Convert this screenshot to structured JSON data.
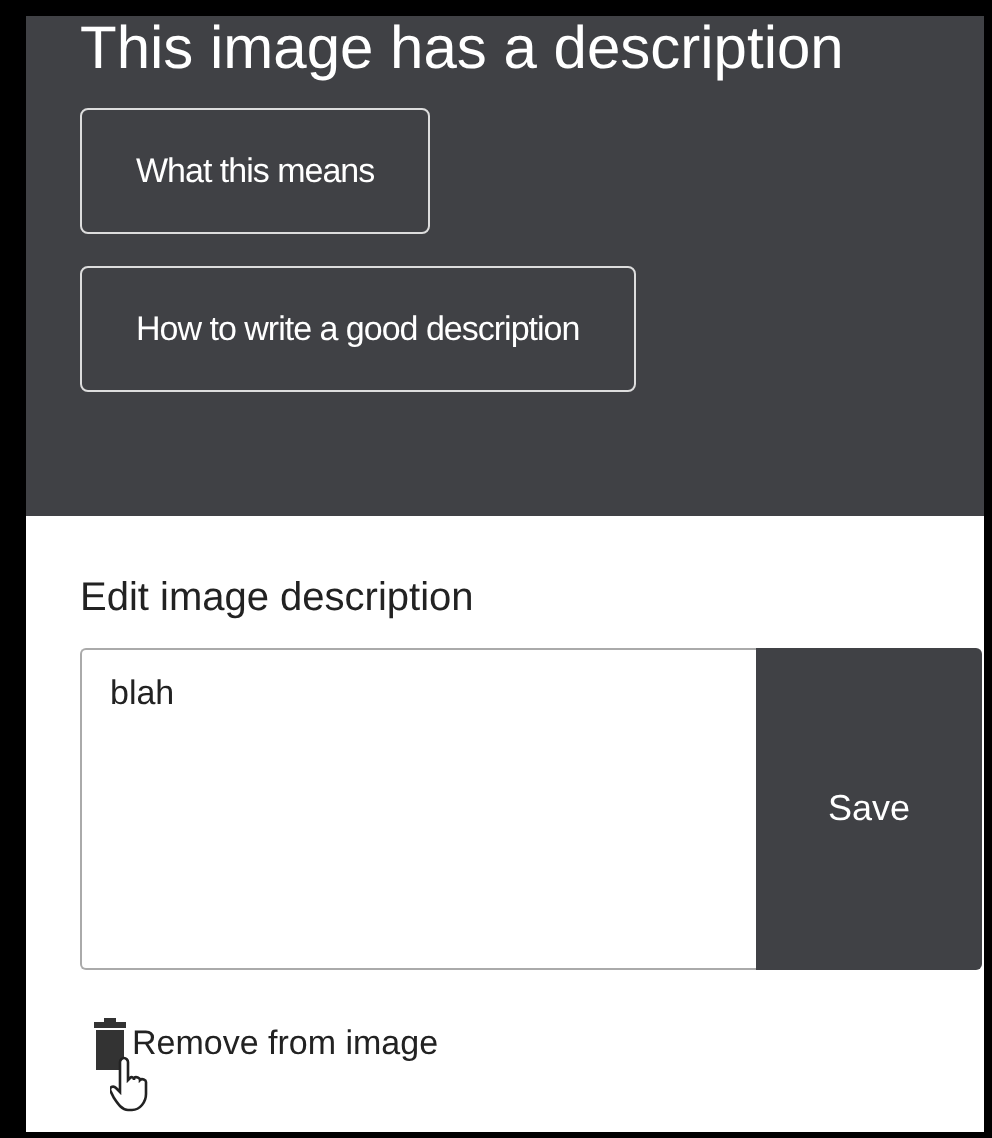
{
  "header": {
    "title": "This image has a description",
    "buttons": [
      "What this means",
      "How to write a good description"
    ]
  },
  "editor": {
    "label": "Edit image description",
    "value": "blah",
    "save": "Save"
  },
  "remove_link": "Remove from image"
}
